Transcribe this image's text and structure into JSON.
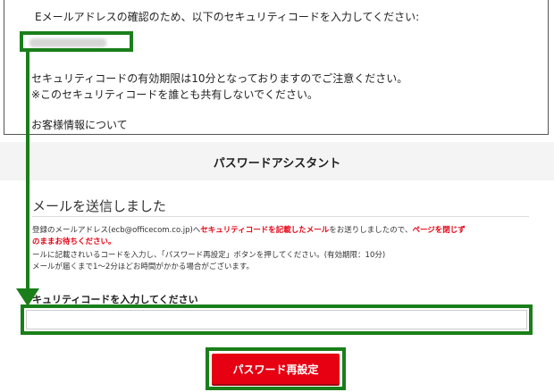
{
  "email": {
    "line1": "Eメールアドレスの確認のため、以下のセキュリティコードを入力してください:",
    "line2": "セキュリティコードの有効期限は10分となっておりますのでご注意ください。",
    "line3": "※このセキュリティコードを誰とも共有しないでください。",
    "line4": "お客様情報について"
  },
  "assistant": {
    "title": "パスワードアシスタント",
    "sent_heading": "メールを送信しました",
    "info1_a": "登録のメールアドレス(ecb@officecom.co.jp)へ",
    "info1_b": "セキュリティコードを記載したメール",
    "info1_c": "をお送りしましたので、",
    "info1_d": "ページを閉じず",
    "info2": "のままお待ちください。",
    "info3": "ールに記載されいるコードを入力し、「パスワード再設定」ボタンを押してください。(有効期限：10分)",
    "info4": "メールが届くまで1〜2分ほどお時間がかかる場合がございます。",
    "code_label": "キュリティコードを入力してください",
    "code_value": "",
    "reset_label": "パスワード再設定"
  },
  "colors": {
    "highlight": "#1a7f1a",
    "accent_red": "#e60012"
  }
}
